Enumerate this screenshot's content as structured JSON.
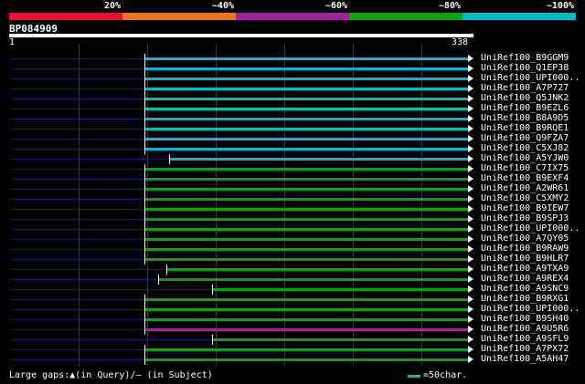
{
  "scale": {
    "colors": [
      "#e8102e",
      "#e87820",
      "#a020a0",
      "#10a010",
      "#00b8c8"
    ],
    "labels": [
      "20%",
      "~40%",
      "~60%",
      "~80%",
      "~100%"
    ]
  },
  "query": {
    "id": "BP084909",
    "start_label": "1",
    "end_label": "338",
    "length": 338
  },
  "rows": [
    {
      "subject": "UniRef100_B9GGM9",
      "color": "#00b8c8",
      "start": 100
    },
    {
      "subject": "UniRef100_Q1EP38",
      "color": "#00b8c8",
      "start": 100
    },
    {
      "subject": "UniRef100_UPI000..",
      "color": "#00b8c8",
      "start": 100
    },
    {
      "subject": "UniRef100_A7P727",
      "color": "#00b8c8",
      "start": 100
    },
    {
      "subject": "UniRef100_Q5JNK2",
      "color": "#00b8c8",
      "start": 100
    },
    {
      "subject": "UniRef100_B9EZL6",
      "color": "#00b8c8",
      "start": 100
    },
    {
      "subject": "UniRef100_B8A9D5",
      "color": "#00b8c8",
      "start": 100
    },
    {
      "subject": "UniRef100_B9RQE1",
      "color": "#00b8c8",
      "start": 100
    },
    {
      "subject": "UniRef100_Q9FZA7",
      "color": "#00b8c8",
      "start": 100
    },
    {
      "subject": "UniRef100_C5XJ82",
      "color": "#00b8c8",
      "start": 100
    },
    {
      "subject": "UniRef100_A5YJW0",
      "color": "#00b8c8",
      "start": 118
    },
    {
      "subject": "UniRef100_C7IX75",
      "color": "#10a010",
      "start": 100
    },
    {
      "subject": "UniRef100_B9EXF4",
      "color": "#10a010",
      "start": 100
    },
    {
      "subject": "UniRef100_A2WR61",
      "color": "#10a010",
      "start": 100
    },
    {
      "subject": "UniRef100_C5XMY2",
      "color": "#10a010",
      "start": 100
    },
    {
      "subject": "UniRef100_B9IEW7",
      "color": "#10a010",
      "start": 100
    },
    {
      "subject": "UniRef100_B9SPJ3",
      "color": "#10a010",
      "start": 100
    },
    {
      "subject": "UniRef100_UPI000..",
      "color": "#10a010",
      "start": 100
    },
    {
      "subject": "UniRef100_A7QY05",
      "color": "#10a010",
      "start": 100
    },
    {
      "subject": "UniRef100_B9RAW9",
      "color": "#10a010",
      "start": 100
    },
    {
      "subject": "UniRef100_B9HLR7",
      "color": "#10a010",
      "start": 100
    },
    {
      "subject": "UniRef100_A9TXA9",
      "color": "#10a010",
      "start": 116
    },
    {
      "subject": "UniRef100_A9REX4",
      "color": "#10a010",
      "start": 110
    },
    {
      "subject": "UniRef100_A9SNC9",
      "color": "#10a010",
      "start": 150
    },
    {
      "subject": "UniRef100_B9RXG1",
      "color": "#10a010",
      "start": 100
    },
    {
      "subject": "UniRef100_UPI000..",
      "color": "#10a010",
      "start": 100
    },
    {
      "subject": "UniRef100_B9SH40",
      "color": "#10a010",
      "start": 100
    },
    {
      "subject": "UniRef100_A9U5R6",
      "color": "#a020a0",
      "start": 100
    },
    {
      "subject": "UniRef100_A9SFL9",
      "color": "#10a010",
      "start": 150
    },
    {
      "subject": "UniRef100_A7PX72",
      "color": "#10a010",
      "start": 100
    },
    {
      "subject": "UniRef100_A5AH47",
      "color": "#10a010",
      "start": 100
    }
  ],
  "legend": {
    "gap_text": "Large gaps:▲(in Query)/— (in Subject)",
    "unit_text": "=50char.",
    "swatch_color": "#00b8c8"
  }
}
